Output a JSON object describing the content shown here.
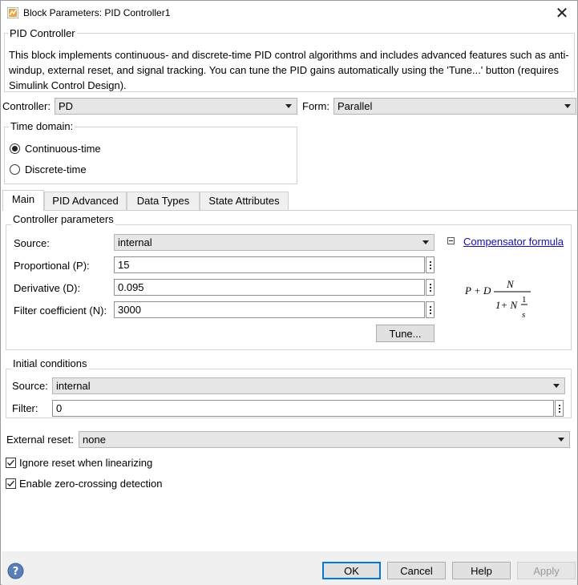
{
  "window": {
    "title": "Block Parameters: PID Controller1"
  },
  "header": {
    "group_label": "PID Controller",
    "description": "This block implements continuous- and discrete-time PID control algorithms and includes advanced features such as anti-windup, external reset, and signal tracking. You can tune the PID gains automatically using the 'Tune...' button (requires Simulink Control Design)."
  },
  "controller": {
    "label": "Controller:",
    "value": "PD"
  },
  "form": {
    "label": "Form:",
    "value": "Parallel"
  },
  "time_domain": {
    "label": "Time domain:",
    "options": [
      {
        "label": "Continuous-time",
        "selected": true
      },
      {
        "label": "Discrete-time",
        "selected": false
      }
    ]
  },
  "tabs": [
    {
      "label": "Main",
      "active": true
    },
    {
      "label": "PID Advanced",
      "active": false
    },
    {
      "label": "Data Types",
      "active": false
    },
    {
      "label": "State Attributes",
      "active": false
    }
  ],
  "controller_parameters": {
    "label": "Controller parameters",
    "source_label": "Source:",
    "source_value": "internal",
    "proportional_label": "Proportional (P):",
    "proportional_value": "15",
    "derivative_label": "Derivative (D):",
    "derivative_value": "0.095",
    "filter_label": "Filter coefficient (N):",
    "filter_value": "3000",
    "tune_button": "Tune...",
    "compensator_link": "Compensator formula",
    "formula": {
      "pd": "P + D",
      "num": "N",
      "den_prefix": "1+ N",
      "frac_num": "1",
      "frac_den": "s"
    }
  },
  "initial_conditions": {
    "label": "Initial conditions",
    "source_label": "Source:",
    "source_value": "internal",
    "filter_label": "Filter:",
    "filter_value": "0"
  },
  "external_reset": {
    "label": "External reset:",
    "value": "none"
  },
  "checkboxes": [
    {
      "label": "Ignore reset when linearizing",
      "checked": true
    },
    {
      "label": "Enable zero-crossing detection",
      "checked": true
    }
  ],
  "footer": {
    "ok": "OK",
    "cancel": "Cancel",
    "help": "Help",
    "apply": "Apply"
  }
}
